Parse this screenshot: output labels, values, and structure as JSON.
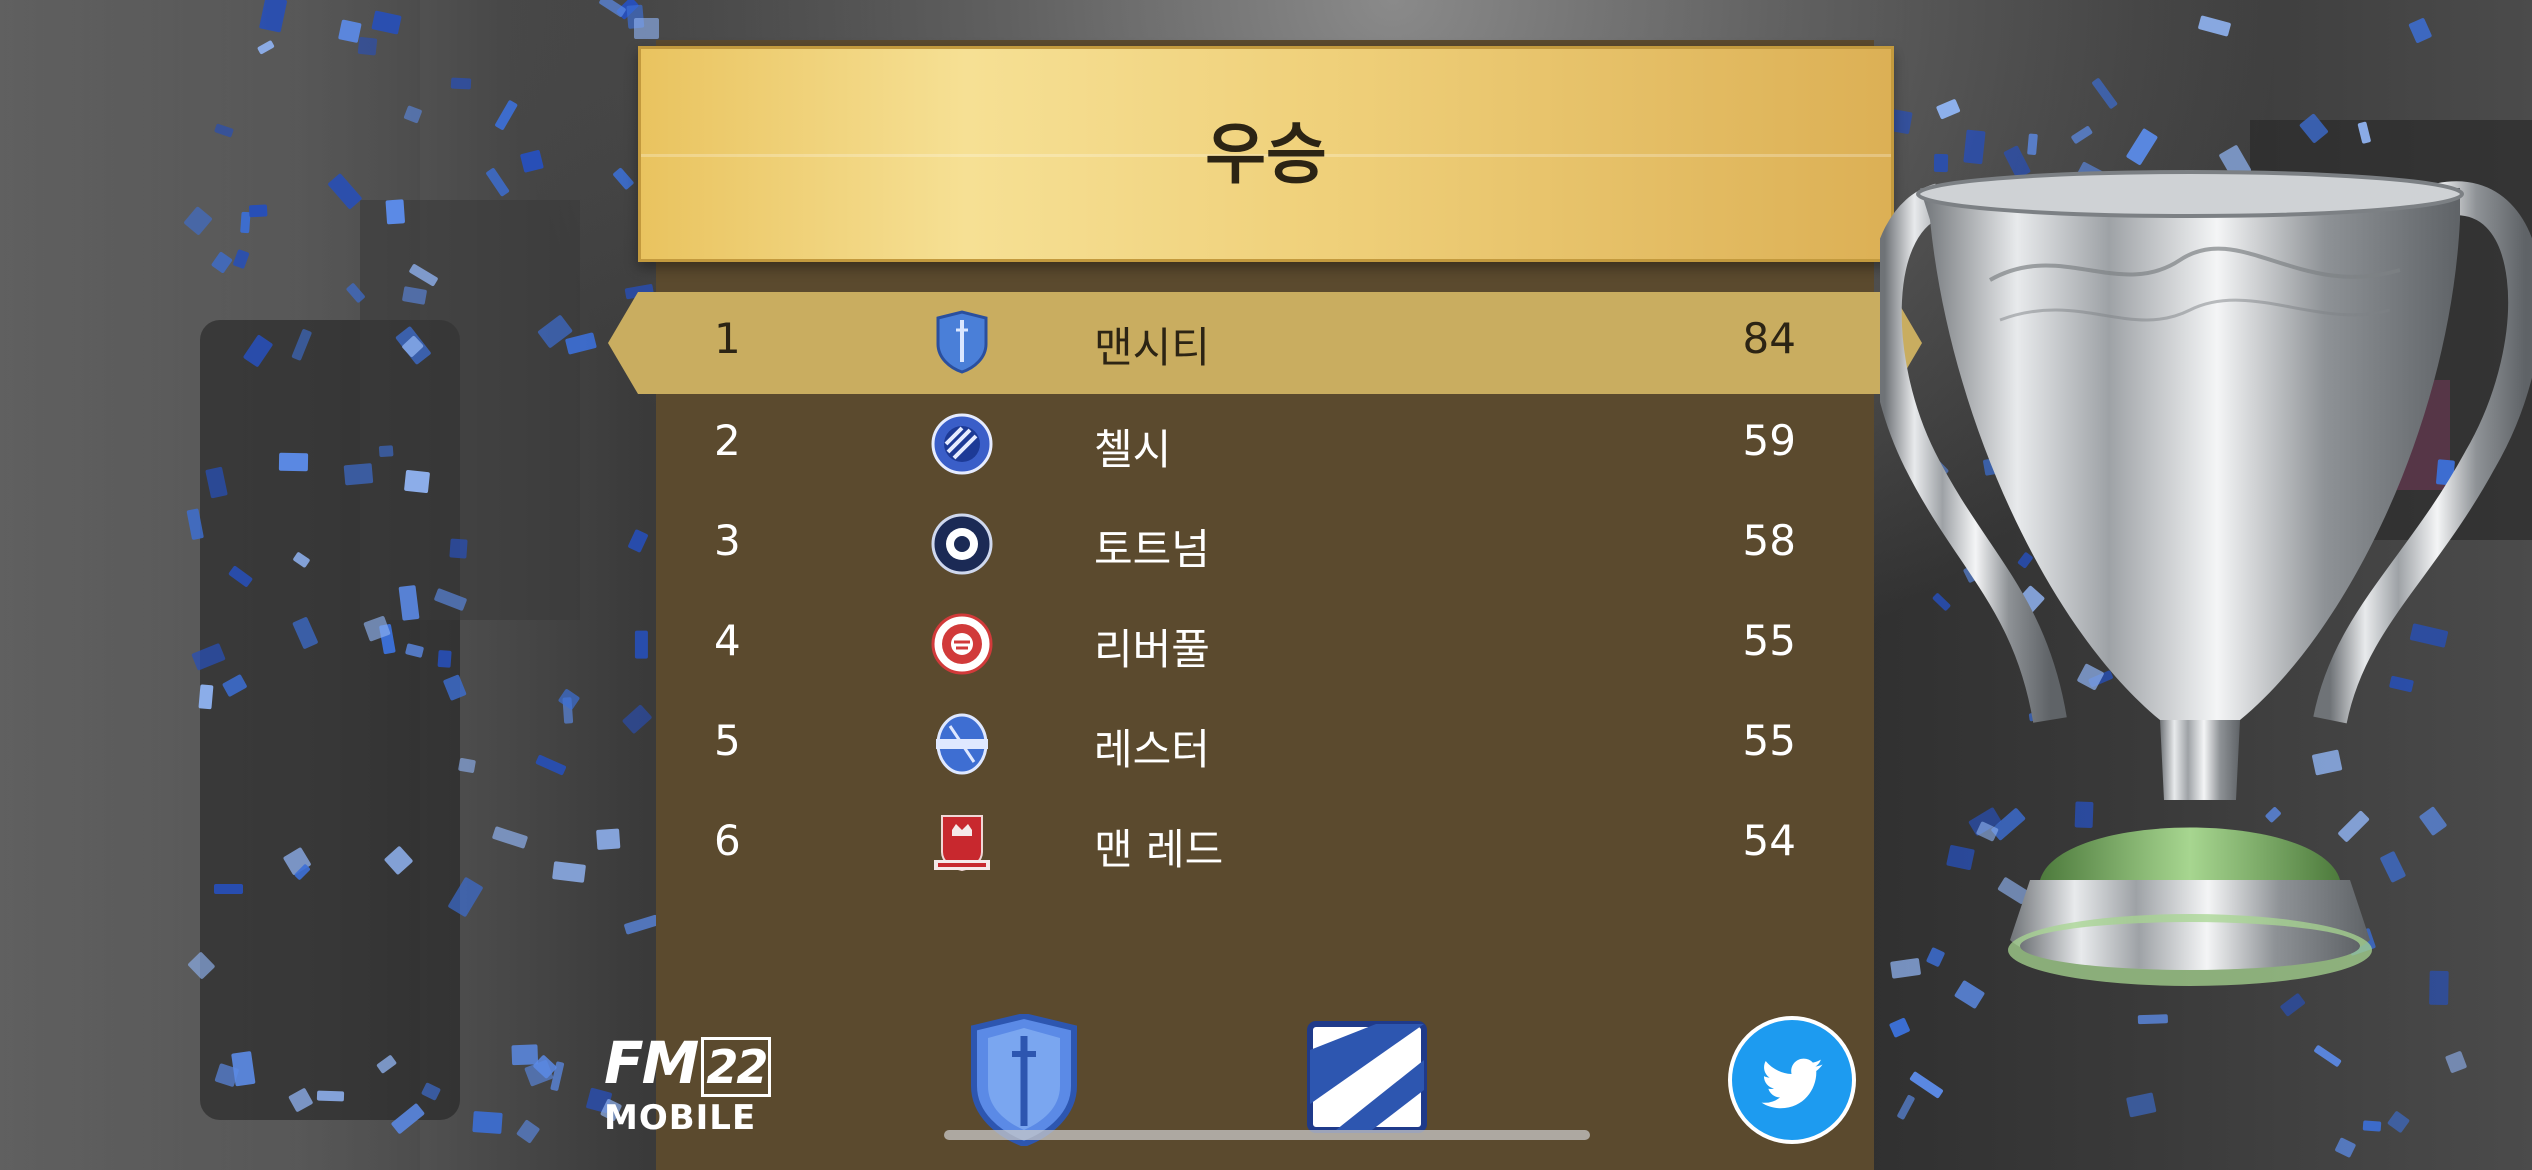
{
  "header": {
    "title": "우승"
  },
  "standings": [
    {
      "rank": "1",
      "team": "맨시티",
      "points": "84",
      "crest": "man-city-crest-icon"
    },
    {
      "rank": "2",
      "team": "첼시",
      "points": "59",
      "crest": "chelsea-crest-icon"
    },
    {
      "rank": "3",
      "team": "토트넘",
      "points": "58",
      "crest": "tottenham-crest-icon"
    },
    {
      "rank": "4",
      "team": "리버풀",
      "points": "55",
      "crest": "liverpool-crest-icon"
    },
    {
      "rank": "5",
      "team": "레스터",
      "points": "55",
      "crest": "leicester-crest-icon"
    },
    {
      "rank": "6",
      "team": "맨 레드",
      "points": "54",
      "crest": "man-utd-crest-icon"
    }
  ],
  "footer": {
    "logo_line1": "FM",
    "logo_year": "22",
    "logo_line2": "MOBILE",
    "buttons": [
      "club-crest-icon",
      "club-kit-icon",
      "twitter-icon"
    ]
  },
  "colors": {
    "banner": "#efd07a",
    "panel": "#5b4a2e",
    "highlight_row": "#c9ad60",
    "twitter": "#1d9bf0",
    "confetti": [
      "#3c6fd6",
      "#5b8ae6",
      "#8fb2f0",
      "#274fb8"
    ]
  }
}
